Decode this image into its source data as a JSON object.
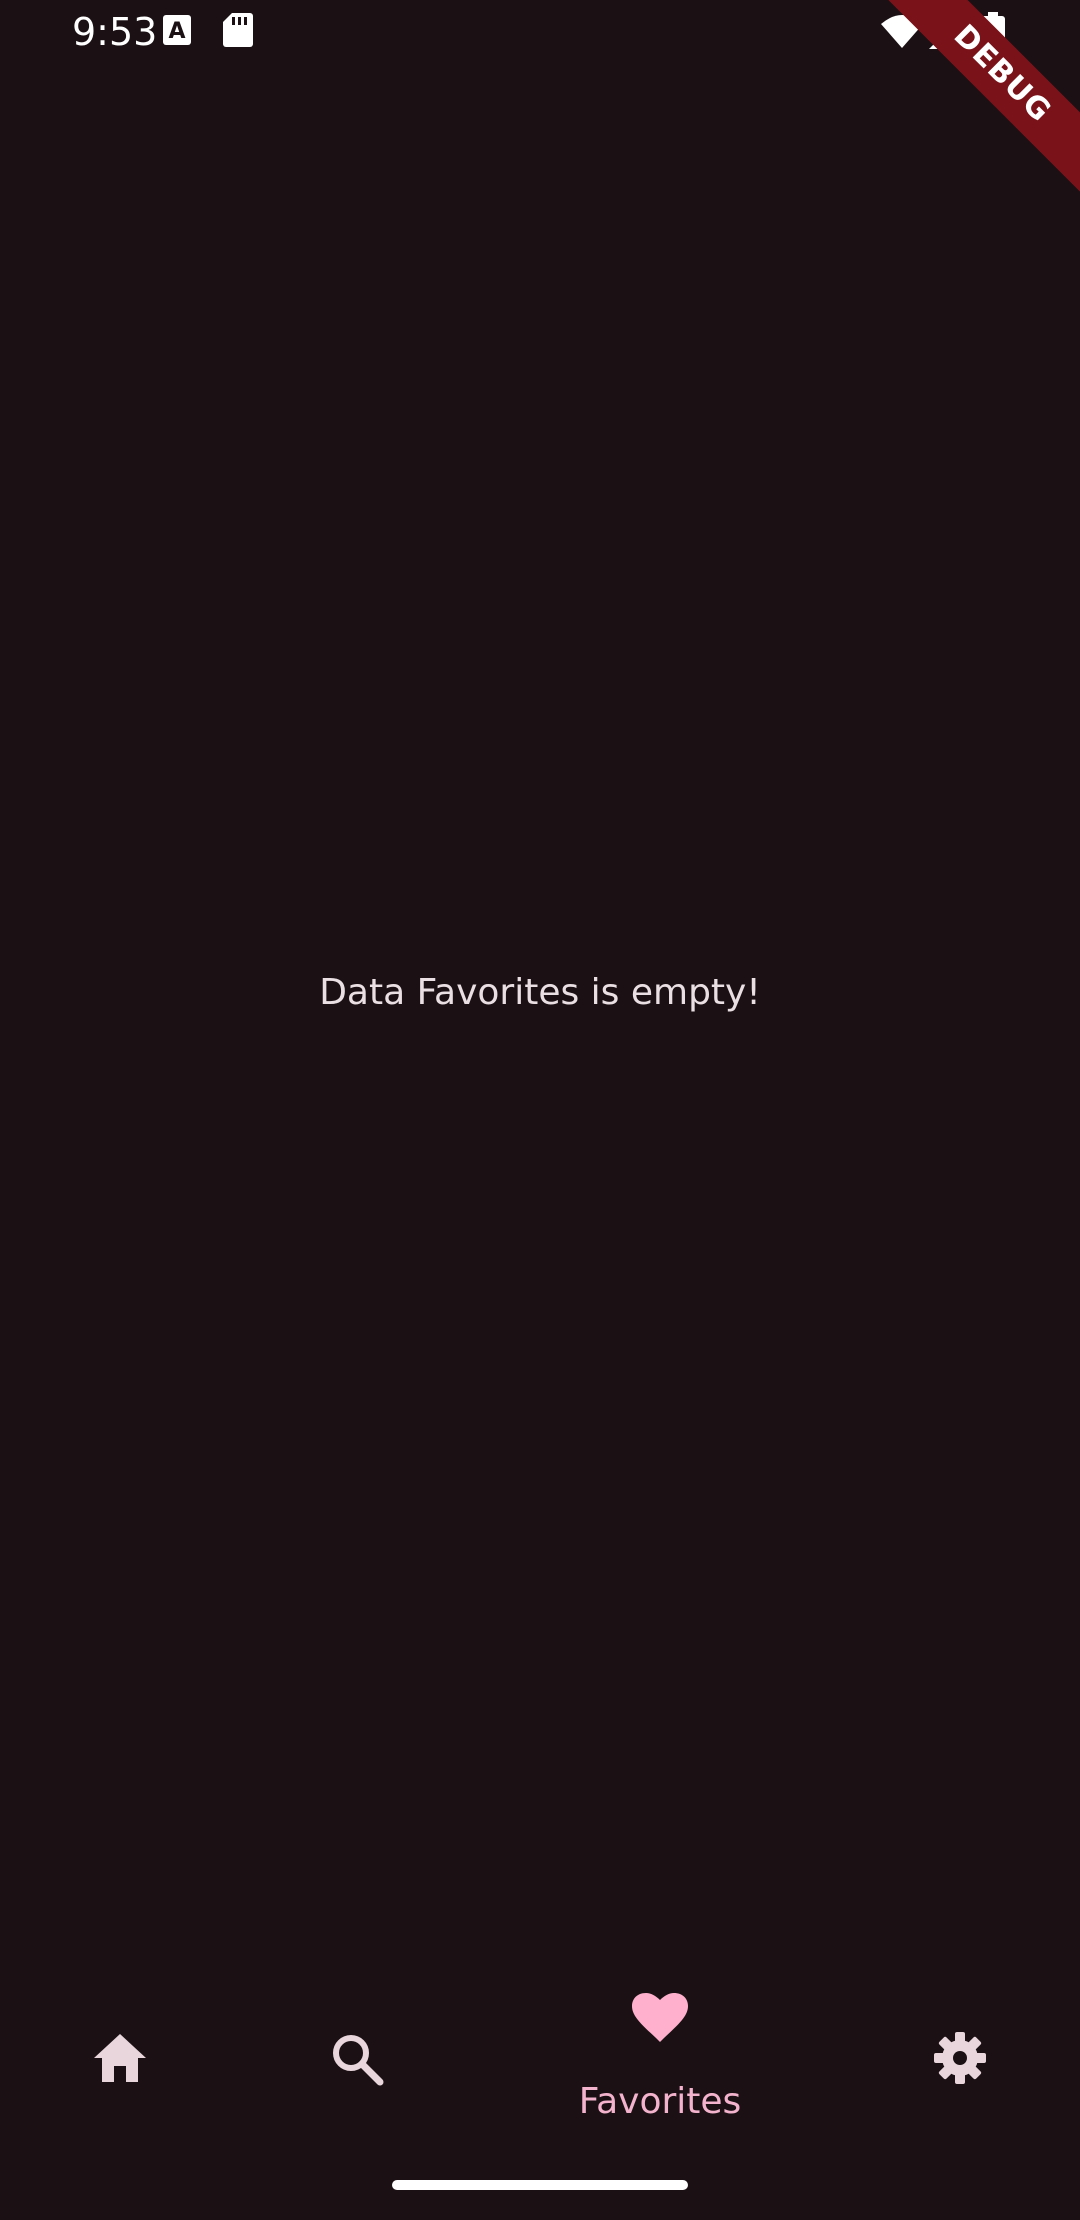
{
  "status_bar": {
    "time": "9:53",
    "icons": [
      "notification-a-icon",
      "sd-card-icon",
      "wifi-icon",
      "signal-icon",
      "battery-icon"
    ]
  },
  "debug_banner": {
    "label": "DEBUG"
  },
  "main": {
    "empty_message": "Data Favorites is empty!"
  },
  "bottom_nav": {
    "items": [
      {
        "id": "home",
        "icon": "home-icon",
        "label": "",
        "active": false
      },
      {
        "id": "search",
        "icon": "search-icon",
        "label": "",
        "active": false
      },
      {
        "id": "favorites",
        "icon": "heart-icon",
        "label": "Favorites",
        "active": true
      },
      {
        "id": "settings",
        "icon": "gear-icon",
        "label": "",
        "active": false
      }
    ],
    "colors": {
      "inactive": "#e8d6dc",
      "active": "#ffb0cd",
      "active_label": "#f3b3cc"
    }
  },
  "colors": {
    "background": "#1b1115",
    "debug_ribbon": "#7a1219"
  }
}
